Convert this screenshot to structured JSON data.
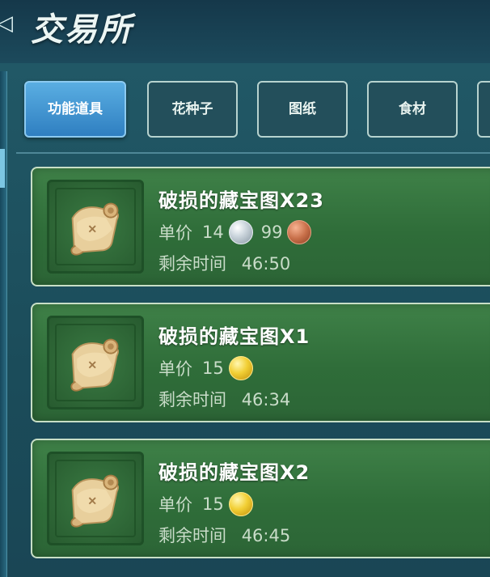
{
  "header": {
    "title": "交易所",
    "back_glyph": "◁"
  },
  "tabs": [
    {
      "label": "功能道具",
      "active": true
    },
    {
      "label": "花种子",
      "active": false
    },
    {
      "label": "图纸",
      "active": false
    },
    {
      "label": "食材",
      "active": false
    },
    {
      "label": "",
      "active": false
    }
  ],
  "listing_labels": {
    "price_label": "单价",
    "time_label": "剩余时间"
  },
  "listings": [
    {
      "name": "破损的藏宝图X23",
      "price": [
        {
          "amount": "14",
          "coin": "silver"
        },
        {
          "amount": "99",
          "coin": "copper"
        }
      ],
      "time_left": "46:50",
      "icon": "treasure-map-scroll-icon"
    },
    {
      "name": "破损的藏宝图X1",
      "price": [
        {
          "amount": "15",
          "coin": "gold"
        }
      ],
      "time_left": "46:34",
      "icon": "treasure-map-scroll-icon"
    },
    {
      "name": "破损的藏宝图X2",
      "price": [
        {
          "amount": "15",
          "coin": "gold"
        }
      ],
      "time_left": "46:45",
      "icon": "treasure-map-scroll-icon"
    }
  ],
  "colors": {
    "background": "#1d4a58",
    "active_tab": "#3f93d0",
    "card_green": "#2f6d39",
    "coin_gold": "#f2cf35",
    "coin_silver": "#d2dbe2",
    "coin_copper": "#c8704a"
  }
}
